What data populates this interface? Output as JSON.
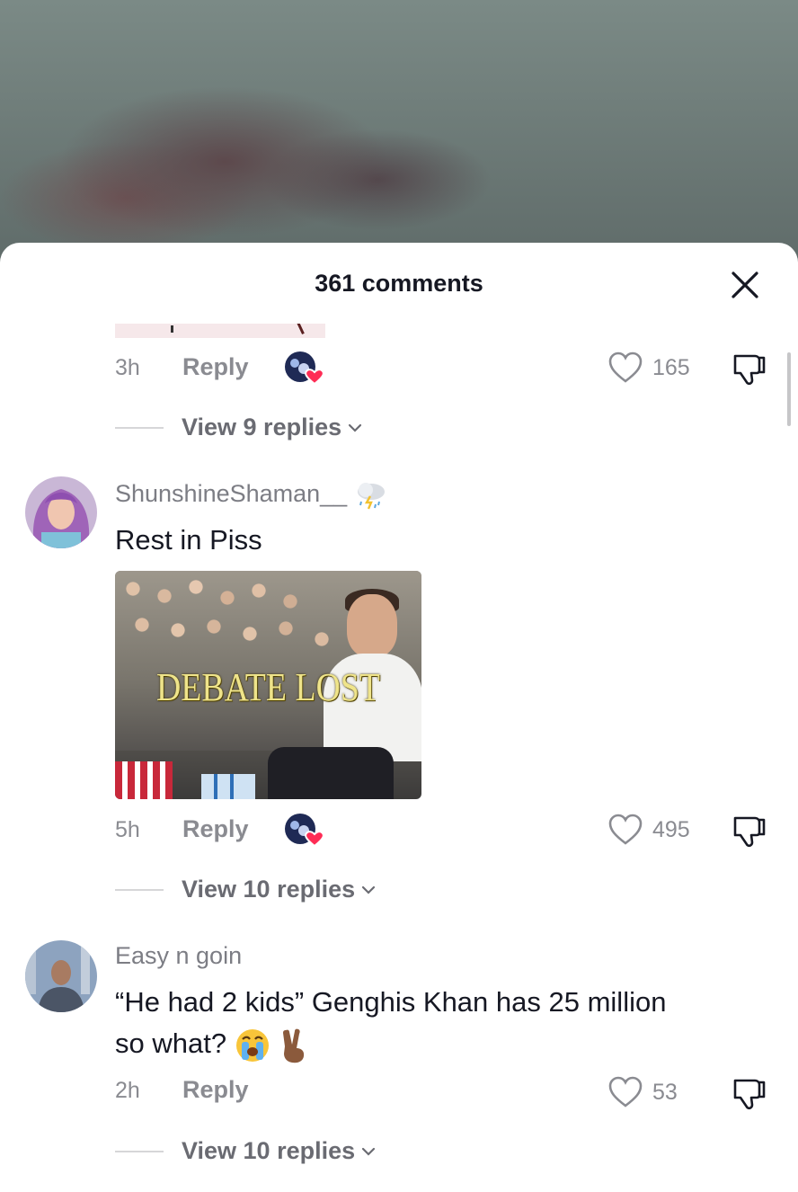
{
  "header": {
    "title": "361 comments"
  },
  "comments_top": {
    "time": "3h",
    "reply_label": "Reply",
    "likes": "165",
    "view_replies": "View 9 replies"
  },
  "comments": [
    {
      "username": "ShunshineShaman__",
      "username_emoji": "cloud-rain-icon",
      "text": "Rest in Piss",
      "image_caption": "DEBATE LOST",
      "time": "5h",
      "reply_label": "Reply",
      "likes": "495",
      "view_replies": "View 10 replies"
    },
    {
      "username": "Easy n goin",
      "text_line1": "“He had 2 kids” Genghis Khan has 25 million",
      "text_line2": "so what?",
      "emojis": [
        "loudly-crying-face-icon",
        "victory-hand-icon"
      ],
      "time": "2h",
      "reply_label": "Reply",
      "likes": "53",
      "view_replies": "View 10 replies"
    }
  ],
  "colors": {
    "text_primary": "#161823",
    "text_secondary": "#8a8b91",
    "heart_red": "#fe2c55"
  }
}
